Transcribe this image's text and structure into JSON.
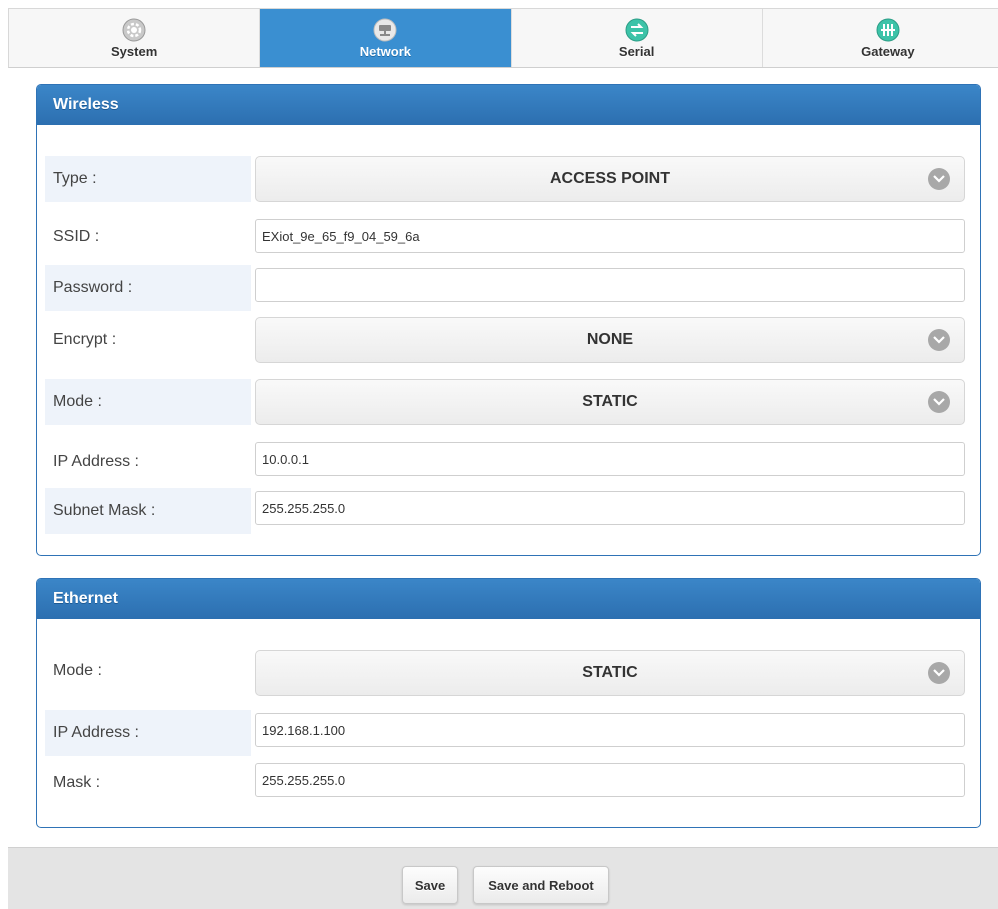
{
  "nav": {
    "tabs": [
      {
        "label": "System",
        "icon": "gear-icon",
        "icon_color": "#b5b5b5"
      },
      {
        "label": "Network",
        "icon": "network-icon",
        "icon_color": "#e6e6e6"
      },
      {
        "label": "Serial",
        "icon": "serial-arrows-icon",
        "icon_color": "#3cc3a8"
      },
      {
        "label": "Gateway",
        "icon": "gateway-icon",
        "icon_color": "#3cc3a8"
      }
    ],
    "active": "Network",
    "active_color": "#3a8fd1"
  },
  "wireless": {
    "title": "Wireless",
    "type_label": "Type :",
    "type_value": "ACCESS POINT",
    "ssid_label": "SSID :",
    "ssid_value": "EXiot_9e_65_f9_04_59_6a",
    "password_label": "Password :",
    "password_value": "",
    "encrypt_label": "Encrypt :",
    "encrypt_value": "NONE",
    "mode_label": "Mode :",
    "mode_value": "STATIC",
    "ip_label": "IP Address :",
    "ip_value": "10.0.0.1",
    "subnet_label": "Subnet Mask :",
    "subnet_value": "255.255.255.0"
  },
  "ethernet": {
    "title": "Ethernet",
    "mode_label": "Mode :",
    "mode_value": "STATIC",
    "ip_label": "IP Address :",
    "ip_value": "192.168.1.100",
    "mask_label": "Mask :",
    "mask_value": "255.255.255.0"
  },
  "footer": {
    "save_label": "Save",
    "save_reboot_label": "Save and Reboot"
  },
  "colors": {
    "panel_header": "#2f73b6",
    "label_bg": "#eef3fa"
  }
}
